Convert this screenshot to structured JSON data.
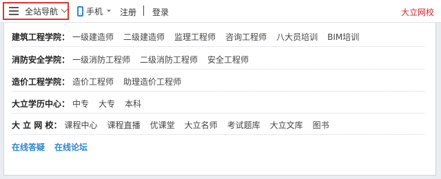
{
  "topbar": {
    "nav_label": "全站导航",
    "mobile_label": "手机",
    "register": "注册",
    "login": "登录",
    "brand": "大立网校"
  },
  "colors": {
    "accent_red": "#d2232a",
    "link_blue": "#2a86d5"
  },
  "categories": [
    {
      "title": "建筑工程学院：",
      "links": [
        "一级建造师",
        "二级建造师",
        "监理工程师",
        "咨询工程师",
        "八大员培训",
        "BIM培训"
      ]
    },
    {
      "title": "消防安全学院：",
      "links": [
        "一级消防工程师",
        "二级消防工程师",
        "安全工程师"
      ]
    },
    {
      "title": "造价工程学院：",
      "links": [
        "造价工程师",
        "助理造价工程师"
      ]
    },
    {
      "title": "大立学历中心：",
      "links": [
        "中专",
        "大专",
        "本科"
      ]
    },
    {
      "title": "大 立 网 校：",
      "links": [
        "课程中心",
        "课程直播",
        "优课堂",
        "大立名师",
        "考试题库",
        "大立文库",
        "图书"
      ]
    }
  ],
  "bottom_links": [
    "在线答疑",
    "在线论坛"
  ]
}
